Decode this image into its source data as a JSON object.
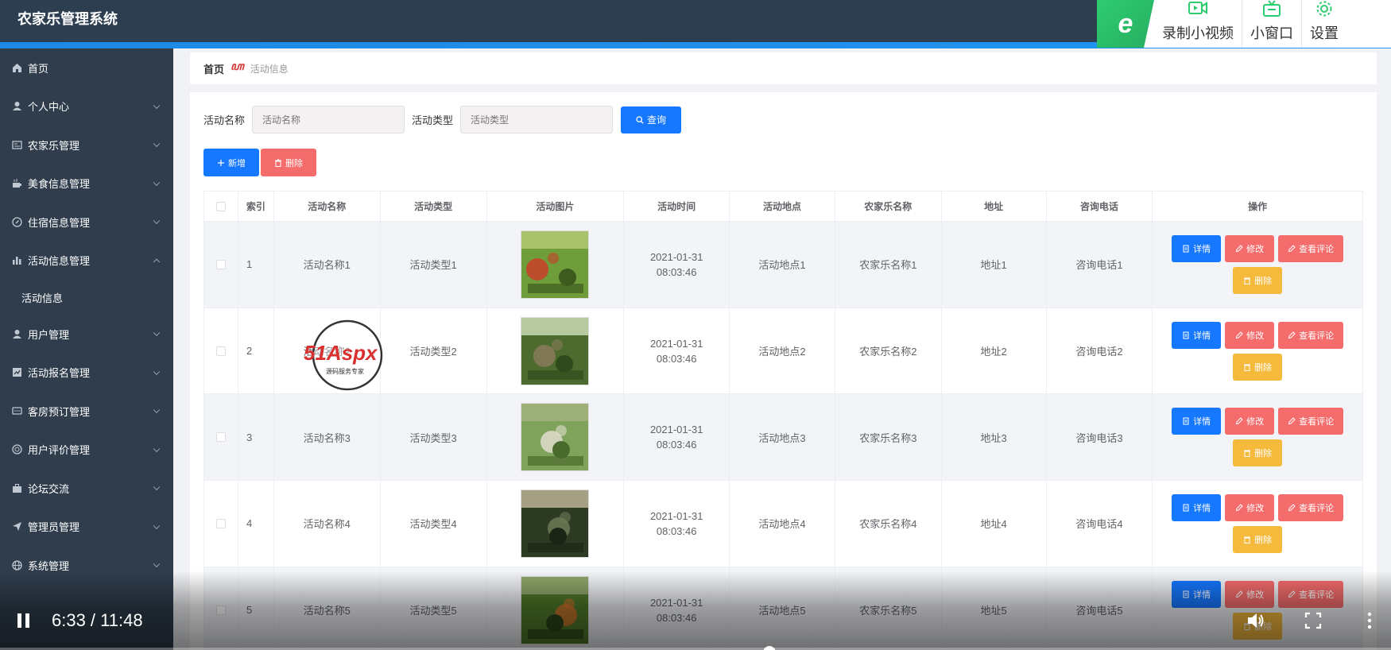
{
  "app": {
    "title": "农家乐管理系统"
  },
  "toolbar": {
    "logo_glyph": "e",
    "items": [
      {
        "label": "录制小视频",
        "icon": "video-record-icon"
      },
      {
        "label": "小窗口",
        "icon": "tv-icon"
      },
      {
        "label": "设置",
        "icon": "gear-icon"
      }
    ]
  },
  "sidebar": {
    "items": [
      {
        "label": "首页",
        "icon": "home-icon"
      },
      {
        "label": "个人中心",
        "icon": "user-icon"
      },
      {
        "label": "农家乐管理",
        "icon": "card-icon"
      },
      {
        "label": "美食信息管理",
        "icon": "food-icon"
      },
      {
        "label": "住宿信息管理",
        "icon": "compass-icon"
      },
      {
        "label": "活动信息管理",
        "icon": "bar-chart-icon",
        "expanded": true
      },
      {
        "label": "活动信息",
        "sub": true
      },
      {
        "label": "用户管理",
        "icon": "user-icon"
      },
      {
        "label": "活动报名管理",
        "icon": "chart-icon"
      },
      {
        "label": "客房预订管理",
        "icon": "chat-icon"
      },
      {
        "label": "用户评价管理",
        "icon": "globe-icon"
      },
      {
        "label": "论坛交流",
        "icon": "briefcase-icon"
      },
      {
        "label": "管理员管理",
        "icon": "send-icon"
      },
      {
        "label": "系统管理",
        "icon": "globe-icon"
      }
    ]
  },
  "breadcrumb": {
    "home": "首页",
    "current": "活动信息"
  },
  "search": {
    "name_label": "活动名称",
    "name_placeholder": "活动名称",
    "type_label": "活动类型",
    "type_placeholder": "活动类型",
    "query_label": "查询"
  },
  "actions": {
    "add_label": "新增",
    "delete_label": "删除"
  },
  "table": {
    "columns": [
      "",
      "索引",
      "活动名称",
      "活动类型",
      "活动图片",
      "活动时间",
      "活动地点",
      "农家乐名称",
      "地址",
      "咨询电话",
      "操作"
    ],
    "row_buttons": {
      "detail": "详情",
      "edit": "修改",
      "review": "查看评论",
      "remove": "删除"
    },
    "rows": [
      {
        "index": "1",
        "name": "活动名称1",
        "type": "活动类型1",
        "time": "2021-01-31 08:03:46",
        "place": "活动地点1",
        "farm": "农家乐名称1",
        "address": "地址1",
        "phone": "咨询电话1"
      },
      {
        "index": "2",
        "name": "活动名称2",
        "type": "活动类型2",
        "time": "2021-01-31 08:03:46",
        "place": "活动地点2",
        "farm": "农家乐名称2",
        "address": "地址2",
        "phone": "咨询电话2"
      },
      {
        "index": "3",
        "name": "活动名称3",
        "type": "活动类型3",
        "time": "2021-01-31 08:03:46",
        "place": "活动地点3",
        "farm": "农家乐名称3",
        "address": "地址3",
        "phone": "咨询电话3"
      },
      {
        "index": "4",
        "name": "活动名称4",
        "type": "活动类型4",
        "time": "2021-01-31 08:03:46",
        "place": "活动地点4",
        "farm": "农家乐名称4",
        "address": "地址4",
        "phone": "咨询电话4"
      },
      {
        "index": "5",
        "name": "活动名称5",
        "type": "活动类型5",
        "time": "2021-01-31 08:03:46",
        "place": "活动地点5",
        "farm": "农家乐名称5",
        "address": "地址5",
        "phone": "咨询电话5"
      }
    ]
  },
  "watermark": {
    "brand": "51Aspx",
    "tagline": "源码服务专家"
  },
  "video": {
    "time": "6:33 / 11:48",
    "progress": 0.553
  },
  "colors": {
    "primary": "#1677ff",
    "danger": "#f56c6c",
    "warning": "#f5b93c",
    "sidebar": "#2f3d4c",
    "header": "#2c3e50"
  }
}
